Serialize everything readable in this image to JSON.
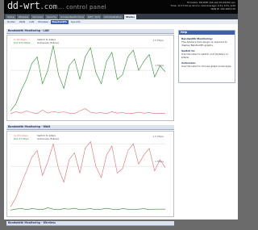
{
  "header": {
    "logo": {
      "brand": "dd-wrt",
      "dotcom": ".com",
      "tagline": "... control panel"
    },
    "info": [
      "Firmware: DD-WRT v24-sp2 (01/15/09) vpn",
      "Time: 12:17:04 up 22 min, load average: 0.31, 0.31, 0.09",
      "WAN IP: 192.168.1.20"
    ]
  },
  "menu": [
    "Setup",
    "Wireless",
    "Services",
    "Security",
    "Access Restrictions",
    "NAT / QoS",
    "Administration",
    "Status"
  ],
  "active_menu": "Status",
  "submenu": [
    "Router",
    "WAN",
    "LAN",
    "Wireless",
    "Bandwidth",
    "Sys-Info"
  ],
  "active_submenu": "Bandwidth",
  "sections": [
    {
      "title": "Bandwidth Monitoring - LAN",
      "in": "In   44 Kbps",
      "out": "Out  971 Kbps",
      "switch1": "Switch to bits/s",
      "switch2": "Autoscale (follow)",
      "label_top": "1.5 Mbps",
      "label_mid": "1 Mbps"
    },
    {
      "title": "Bandwidth Monitoring - WAN",
      "in": "In   971 Kbps",
      "out": "Out  47 Kbps",
      "switch1": "Switch to bits/s",
      "switch2": "Autoscale (follow)",
      "label_top": "1.5 Mbps",
      "label_mid": "1 Mbps"
    },
    {
      "title": "Bandwidth Monitoring - Wireless"
    }
  ],
  "help": {
    "title": "Help",
    "items": [
      {
        "heading": "Bandwidth Monitoring:",
        "text": "The Adobe's SVG plugin is required to display Bandwidth graphs."
      },
      {
        "heading": "Switch to:",
        "text": "Use the label to switch unit (bytes/s or bits/s)."
      },
      {
        "heading": "Autoscale:",
        "text": "Use the label to choose graph scale type."
      }
    ]
  },
  "colors": {
    "incoming": "#e06c6c",
    "outgoing": "#2a8a2a",
    "header_bg": "#050505",
    "accent": "#3f5fa8"
  },
  "chart_data": [
    {
      "type": "line",
      "title": "Bandwidth Monitoring - LAN",
      "ylim": [
        0,
        1.7
      ],
      "series": [
        {
          "name": "In",
          "values": [
            0.04,
            0.08,
            0.05,
            0.1,
            0.06,
            0.04,
            0.12,
            0.05,
            0.09,
            0.06,
            0.08,
            0.05,
            0.04,
            0.1,
            0.15,
            0.07,
            0.05,
            0.06,
            0.04,
            0.08,
            0.05,
            0.06,
            0.04,
            0.05,
            0.07,
            0.05,
            0.06,
            0.04,
            0.05,
            0.04
          ]
        },
        {
          "name": "Out",
          "values": [
            0.1,
            0.25,
            0.55,
            0.8,
            1.15,
            1.3,
            0.7,
            1.0,
            1.55,
            0.9,
            0.6,
            1.1,
            1.25,
            0.8,
            1.3,
            1.5,
            0.95,
            0.7,
            1.2,
            1.4,
            0.8,
            0.9,
            1.3,
            1.45,
            1.0,
            1.2,
            1.35,
            0.85,
            1.1,
            0.97
          ]
        }
      ]
    },
    {
      "type": "line",
      "title": "Bandwidth Monitoring - WAN",
      "ylim": [
        0,
        1.7
      ],
      "series": [
        {
          "name": "In",
          "values": [
            0.1,
            0.3,
            0.6,
            0.9,
            1.2,
            1.35,
            0.8,
            1.1,
            1.5,
            0.95,
            0.65,
            1.15,
            1.3,
            0.85,
            1.4,
            1.55,
            1.0,
            0.75,
            1.25,
            1.45,
            0.85,
            0.95,
            1.35,
            1.5,
            1.05,
            1.25,
            1.4,
            0.9,
            1.15,
            0.97
          ]
        },
        {
          "name": "Out",
          "values": [
            0.03,
            0.05,
            0.07,
            0.04,
            0.06,
            0.05,
            0.04,
            0.08,
            0.05,
            0.04,
            0.06,
            0.05,
            0.07,
            0.04,
            0.05,
            0.06,
            0.04,
            0.05,
            0.07,
            0.05,
            0.04,
            0.06,
            0.05,
            0.04,
            0.05,
            0.06,
            0.04,
            0.05,
            0.05,
            0.05
          ]
        }
      ]
    }
  ]
}
